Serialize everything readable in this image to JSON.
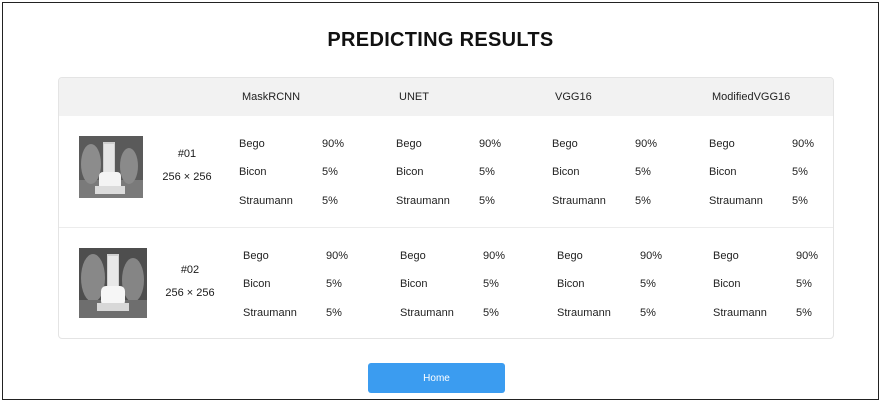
{
  "page": {
    "title": "PREDICTING RESULTS"
  },
  "table": {
    "columns": [
      "MaskRCNN",
      "UNET",
      "VGG16",
      "ModifiedVGG16"
    ],
    "rows": [
      {
        "id": "#01",
        "size": "256 × 256",
        "image_icon": "dental-xray-implant-thumbnail",
        "models": [
          [
            {
              "label": "Bego",
              "value": "90%"
            },
            {
              "label": "Bicon",
              "value": "5%"
            },
            {
              "label": "Straumann",
              "value": "5%"
            }
          ],
          [
            {
              "label": "Bego",
              "value": "90%"
            },
            {
              "label": "Bicon",
              "value": "5%"
            },
            {
              "label": "Straumann",
              "value": "5%"
            }
          ],
          [
            {
              "label": "Bego",
              "value": "90%"
            },
            {
              "label": "Bicon",
              "value": "5%"
            },
            {
              "label": "Straumann",
              "value": "5%"
            }
          ],
          [
            {
              "label": "Bego",
              "value": "90%"
            },
            {
              "label": "Bicon",
              "value": "5%"
            },
            {
              "label": "Straumann",
              "value": "5%"
            }
          ]
        ]
      },
      {
        "id": "#02",
        "size": "256 × 256",
        "image_icon": "dental-xray-implant-thumbnail",
        "models": [
          [
            {
              "label": "Bego",
              "value": "90%"
            },
            {
              "label": "Bicon",
              "value": "5%"
            },
            {
              "label": "Straumann",
              "value": "5%"
            }
          ],
          [
            {
              "label": "Bego",
              "value": "90%"
            },
            {
              "label": "Bicon",
              "value": "5%"
            },
            {
              "label": "Straumann",
              "value": "5%"
            }
          ],
          [
            {
              "label": "Bego",
              "value": "90%"
            },
            {
              "label": "Bicon",
              "value": "5%"
            },
            {
              "label": "Straumann",
              "value": "5%"
            }
          ],
          [
            {
              "label": "Bego",
              "value": "90%"
            },
            {
              "label": "Bicon",
              "value": "5%"
            },
            {
              "label": "Straumann",
              "value": "5%"
            }
          ]
        ]
      }
    ]
  },
  "home_button": {
    "label": "Home"
  },
  "colors": {
    "button": "#3b9cf0",
    "header_bg": "#f2f2f2"
  }
}
